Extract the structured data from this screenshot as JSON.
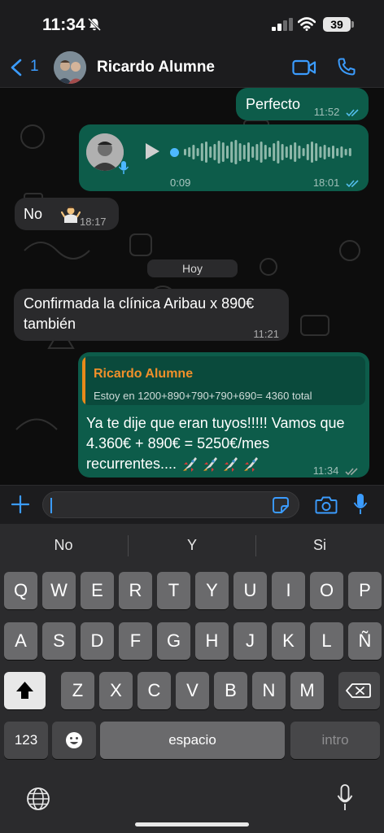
{
  "status_bar": {
    "time": "11:34",
    "battery": "39"
  },
  "header": {
    "back_count": "1",
    "contact_name": "Ricardo Alumne"
  },
  "chat": {
    "messages": [
      {
        "text": "Perfecto",
        "time": "11:52"
      },
      {
        "duration": "0:09",
        "time": "18:01"
      },
      {
        "text": "No",
        "time": "18:17"
      },
      {
        "text": "Confirmada la clínica Aribau x 890€ también",
        "time": "11:21"
      },
      {
        "quote_name": "Ricardo Alumne",
        "quote_text": "Estoy en 1200+890+790+790+690= 4360 total",
        "text": "Ya te dije que eran tuyos!!!!! Vamos que 4.360€ + 890€ = 5250€/mes recurrentes....",
        "time": "11:34"
      }
    ],
    "date_separator": "Hoy"
  },
  "input": {
    "placeholder": ""
  },
  "keyboard": {
    "suggestions": [
      "No",
      "Y",
      "Si"
    ],
    "row1": [
      "Q",
      "W",
      "E",
      "R",
      "T",
      "Y",
      "U",
      "I",
      "O",
      "P"
    ],
    "row2": [
      "A",
      "S",
      "D",
      "F",
      "G",
      "H",
      "J",
      "K",
      "L",
      "Ñ"
    ],
    "row3": [
      "Z",
      "X",
      "C",
      "V",
      "B",
      "N",
      "M"
    ],
    "numbers_key": "123",
    "space_key": "espacio",
    "return_key": "intro"
  },
  "colors": {
    "accent": "#3b9cff",
    "outgoing": "#0d5c4a",
    "incoming": "#2a2a2c",
    "quote_name": "#f0902a"
  }
}
